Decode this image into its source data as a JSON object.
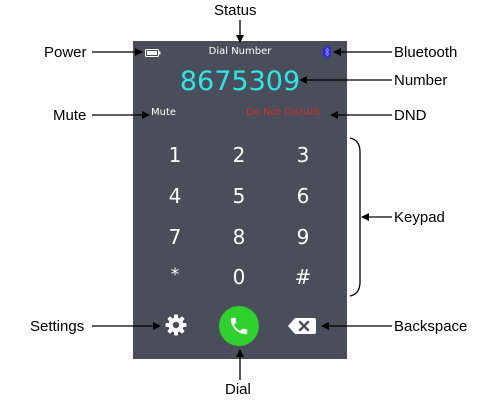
{
  "callouts": {
    "status": "Status",
    "power": "Power",
    "bluetooth": "Bluetooth",
    "number": "Number",
    "mute": "Mute",
    "dnd": "DND",
    "keypad": "Keypad",
    "settings": "Settings",
    "backspace": "Backspace",
    "dial": "Dial"
  },
  "screen": {
    "title": "Dial Number",
    "number": "8675309",
    "mute_label": "Mute",
    "dnd_label": "Do Not Disturb",
    "keys": [
      "1",
      "2",
      "3",
      "4",
      "5",
      "6",
      "7",
      "8",
      "9",
      "*",
      "0",
      "#"
    ],
    "icons": {
      "power": "battery-icon",
      "bluetooth": "bluetooth-icon",
      "settings": "gear-icon",
      "dial": "phone-icon",
      "backspace": "backspace-icon"
    }
  },
  "colors": {
    "screen_bg": "#4a4d5a",
    "number": "#2ee6e6",
    "dnd": "#d0312d",
    "dial_button": "#2fd12f",
    "bluetooth": "#2a2ad6"
  }
}
